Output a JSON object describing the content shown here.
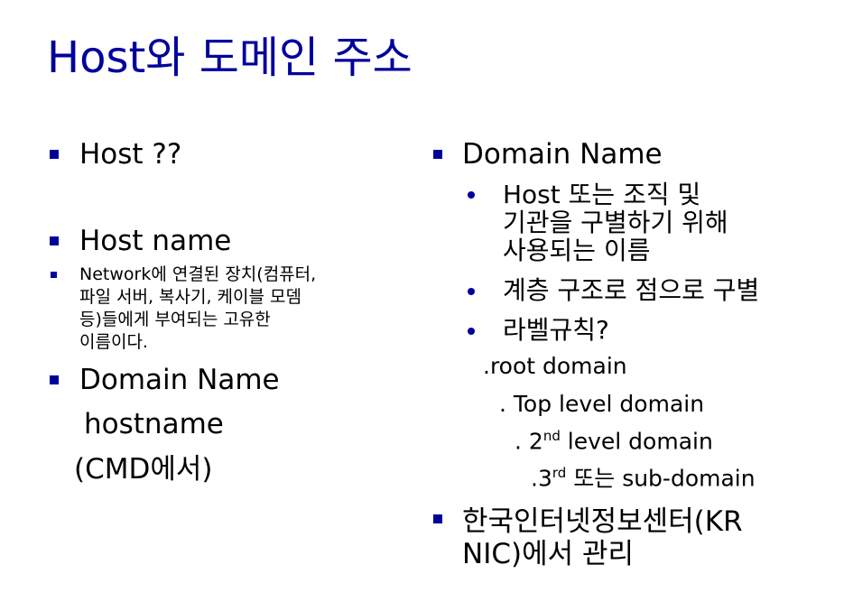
{
  "title": "Host와 도메인 주소",
  "left": {
    "host_q": "Host ??",
    "host_name": "Host name",
    "host_name_desc": [
      "Network에 연결된 장치(컴퓨터,",
      "파일 서버, 복사기, 케이블 모뎀",
      "등)들에게 부여되는 고유한",
      "이름이다."
    ],
    "domain_name": "Domain Name",
    "hostname": "hostname",
    "cmd": "(CMD에서)"
  },
  "right": {
    "domain_name": "Domain Name",
    "sub": [
      [
        "Host 또는 조직 및",
        "기관을 구별하기 위해",
        "사용되는 이름"
      ],
      [
        "계층 구조로 점으로 구별"
      ],
      [
        "라벨규칙?"
      ]
    ],
    "levels": {
      "root": ".root domain",
      "top": ". Top level domain",
      "second_pre": ". 2",
      "second_sup": "nd",
      "second_post": " level domain",
      "third_pre": ".3",
      "third_sup": "rd",
      "third_post": " 또는 sub-domain"
    },
    "krnic": [
      "한국인터넷정보센터(KR",
      "NIC)에서 관리"
    ]
  },
  "colors": {
    "accent": "#00009c"
  }
}
